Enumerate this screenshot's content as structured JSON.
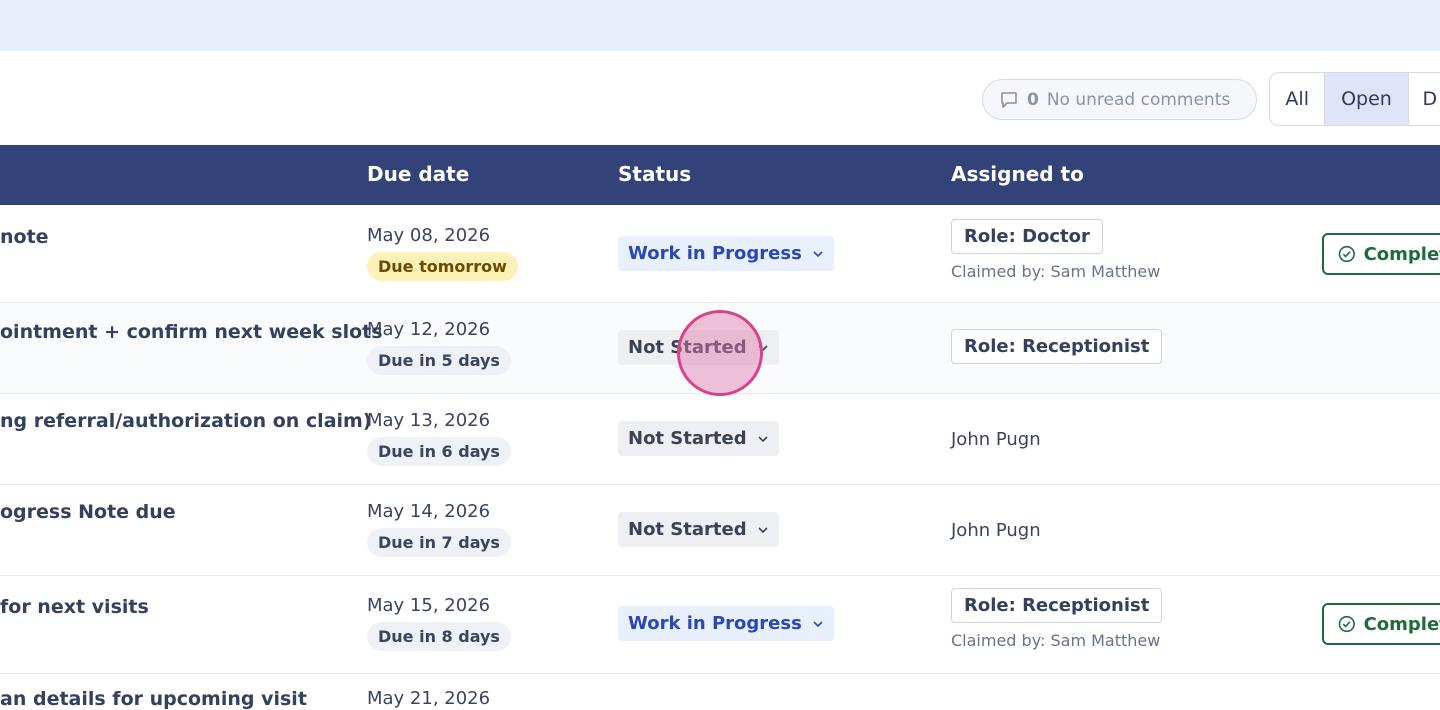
{
  "comments": {
    "count": "0",
    "label": "No unread comments",
    "icon": "comment-icon"
  },
  "filters": {
    "all": "All",
    "open": "Open",
    "done_partial": "D"
  },
  "table": {
    "headers": {
      "due_date": "Due date",
      "status": "Status",
      "assigned_to": "Assigned to"
    },
    "rows": [
      {
        "title": "note",
        "due_date": "May 08, 2026",
        "due_badge": "Due tomorrow",
        "status": "Work in Progress",
        "role": "Role: Doctor",
        "claimed": "Claimed by: Sam Matthew",
        "complete": "Complete"
      },
      {
        "title": "ointment + confirm next week slots",
        "due_date": "May 12, 2026",
        "due_badge": "Due in 5 days",
        "status": "Not Started",
        "role": "Role: Receptionist"
      },
      {
        "title": "ng referral/authorization on claim)",
        "due_date": "May 13, 2026",
        "due_badge": "Due in 6 days",
        "status": "Not Started",
        "assignee": "John Pugn"
      },
      {
        "title": "ogress Note due",
        "due_date": "May 14, 2026",
        "due_badge": "Due in 7 days",
        "status": "Not Started",
        "assignee": "John Pugn"
      },
      {
        "title": "for next visits",
        "due_date": "May 15, 2026",
        "due_badge": "Due in 8 days",
        "status": "Work in Progress",
        "role": "Role: Receptionist",
        "claimed": "Claimed by: Sam Matthew",
        "complete": "Complete"
      },
      {
        "title": "an details for upcoming visit",
        "due_date": "May 21, 2026"
      }
    ]
  },
  "colors": {
    "header_bg": "#34427a",
    "banner_bg": "#e8eefb",
    "wip": "#2947b8",
    "due_soon_bg": "#fcf1b6",
    "complete": "#1f6b3c"
  }
}
